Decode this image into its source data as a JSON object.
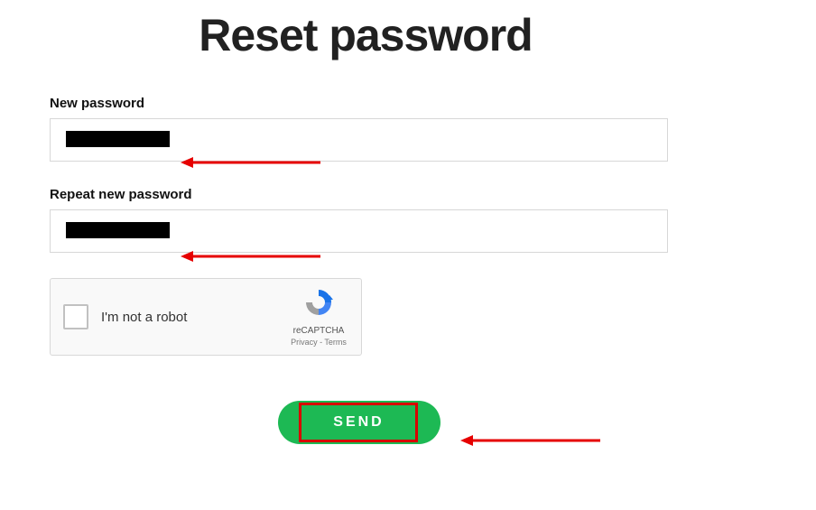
{
  "title": "Reset password",
  "fields": {
    "new_password": {
      "label": "New password",
      "value": ""
    },
    "repeat_password": {
      "label": "Repeat new password",
      "value": ""
    }
  },
  "recaptcha": {
    "label": "I'm not a robot",
    "brand": "reCAPTCHA",
    "links": "Privacy - Terms"
  },
  "buttons": {
    "send_label": "SEND"
  },
  "colors": {
    "accent": "#1db954",
    "highlight": "#d80000"
  }
}
